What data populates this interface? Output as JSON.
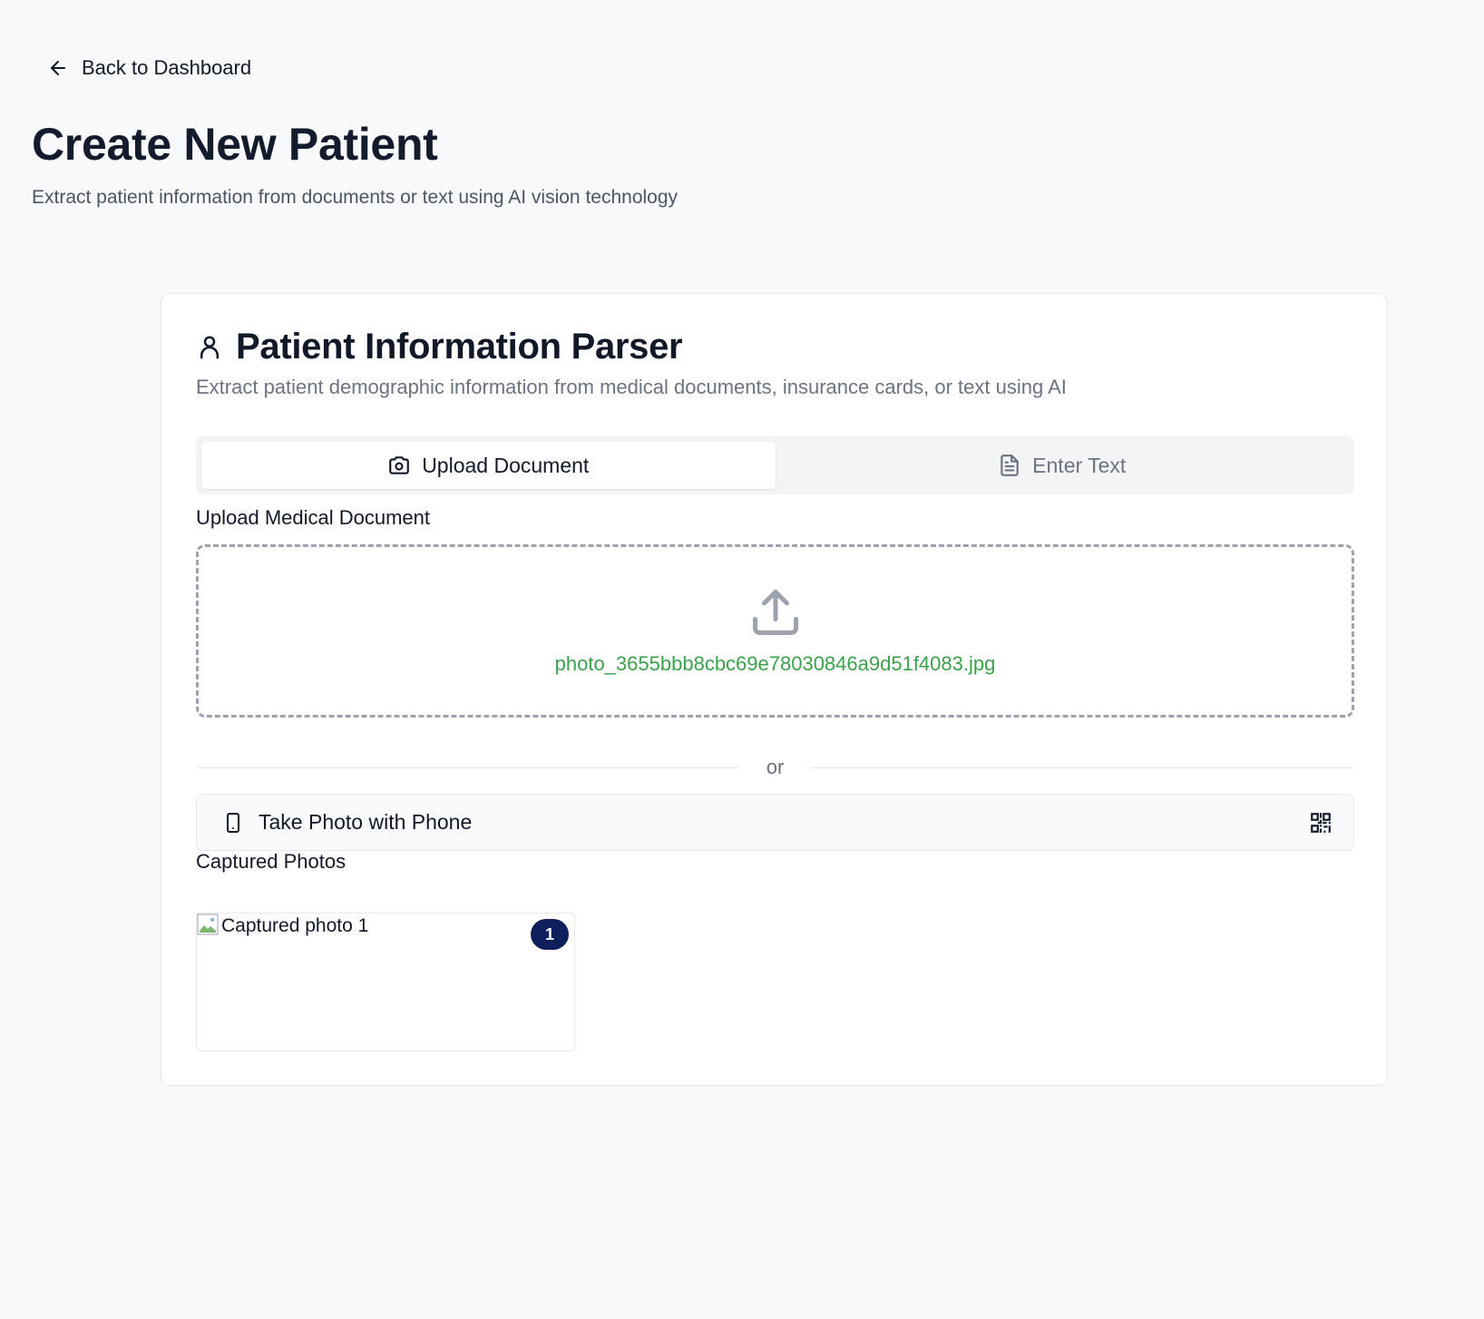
{
  "nav": {
    "back_label": "Back to Dashboard"
  },
  "header": {
    "title": "Create New Patient",
    "subtitle": "Extract patient information from documents or text using AI vision technology"
  },
  "card": {
    "title": "Patient Information Parser",
    "description": "Extract patient demographic information from medical documents, insurance cards, or text using AI",
    "tabs": [
      {
        "label": "Upload Document",
        "icon": "camera-icon",
        "active": true
      },
      {
        "label": "Enter Text",
        "icon": "file-text-icon",
        "active": false
      }
    ],
    "upload": {
      "label": "Upload Medical Document",
      "file_name": "photo_3655bbb8cbc69e78030846a9d51f4083.jpg",
      "icon": "upload-icon",
      "file_color": "#3aa24a"
    },
    "divider_text": "or",
    "phone_button": {
      "label": "Take Photo with Phone",
      "icon": "smartphone-icon",
      "trailing_icon": "qr-code-icon"
    },
    "captured": {
      "label": "Captured Photos",
      "photos": [
        {
          "alt": "Captured photo 1",
          "badge": "1"
        }
      ],
      "badge_color": "#0f1f5c"
    }
  }
}
